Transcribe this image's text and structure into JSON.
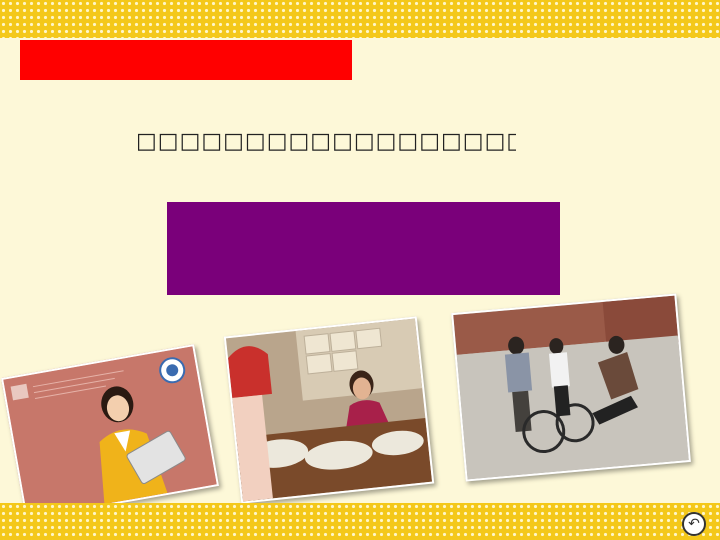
{
  "slide": {
    "title_text": "□□□□□□□□□□□□□□□□□□",
    "nav_glyph": "↶"
  },
  "colors": {
    "background": "#fdf8d8",
    "band": "#f4c81a",
    "red_bar": "#ff0000",
    "purple_box": "#7a007a"
  },
  "images": [
    {
      "icon": "office-woman-illustration"
    },
    {
      "icon": "market-vendor-photo"
    },
    {
      "icon": "street-bicycle-accident-photo"
    }
  ]
}
